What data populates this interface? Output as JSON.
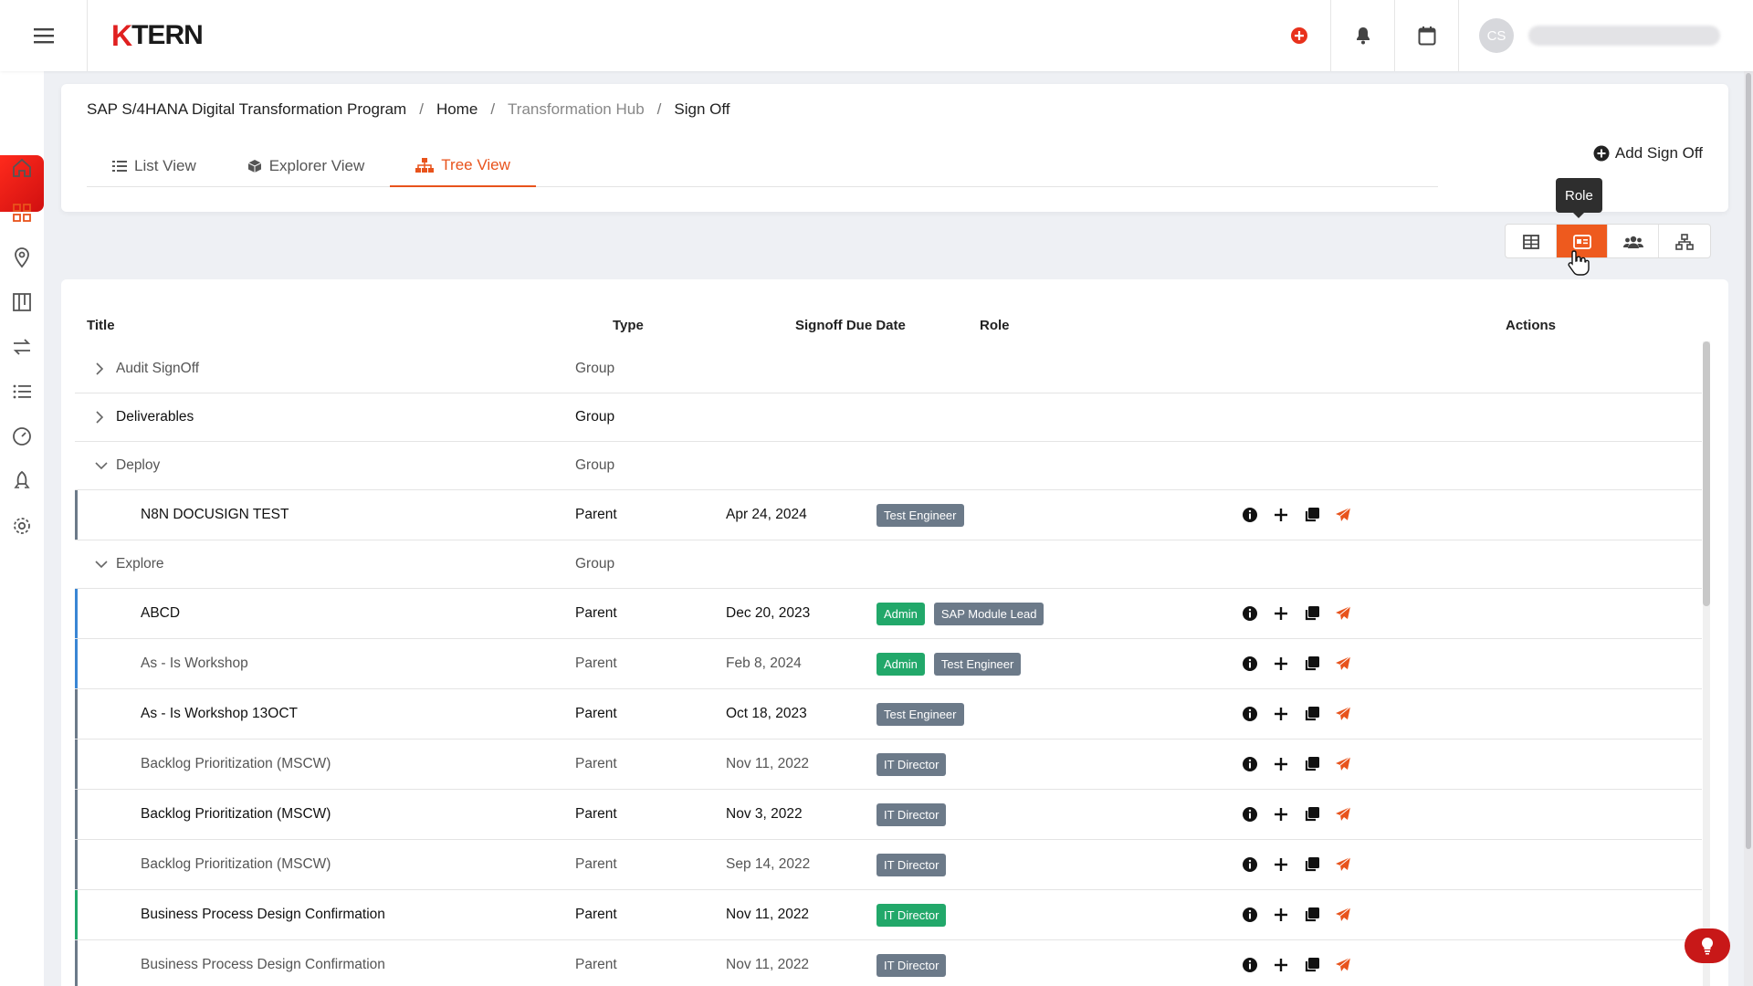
{
  "app": {
    "logo_k": "K",
    "logo_rest": "TERN",
    "avatar_initials": "CS"
  },
  "breadcrumb": {
    "program": "SAP S/4HANA Digital Transformation Program",
    "home": "Home",
    "hub": "Transformation Hub",
    "current": "Sign Off",
    "separator": "/"
  },
  "tabs": [
    {
      "label": "List View",
      "icon": "list-icon"
    },
    {
      "label": "Explorer View",
      "icon": "cube-icon"
    },
    {
      "label": "Tree View",
      "icon": "sitemap-icon",
      "active": true
    }
  ],
  "add_button": "Add Sign Off",
  "view_toggle": {
    "tooltip": "Role",
    "buttons": [
      "table-icon",
      "id-card-icon",
      "users-icon",
      "hierarchy-icon"
    ],
    "active_index": 1
  },
  "table": {
    "columns": {
      "title": "Title",
      "type": "Type",
      "due": "Signoff Due Date",
      "role": "Role",
      "actions": "Actions"
    },
    "rows": [
      {
        "kind": "group",
        "title": "Audit SignOff",
        "type": "Group",
        "expanded": false,
        "bold": false
      },
      {
        "kind": "group",
        "title": "Deliverables",
        "type": "Group",
        "expanded": false,
        "bold": true
      },
      {
        "kind": "group",
        "title": "Deploy",
        "type": "Group",
        "expanded": true,
        "bold": false
      },
      {
        "kind": "child",
        "title": "N8N DOCUSIGN TEST",
        "type": "Parent",
        "due": "Apr 24, 2024",
        "roles": [
          {
            "name": "Test Engineer",
            "color": "#6c7a89"
          }
        ],
        "bar": "#6c7a89",
        "bold": true
      },
      {
        "kind": "group",
        "title": "Explore",
        "type": "Group",
        "expanded": true,
        "bold": false
      },
      {
        "kind": "child",
        "title": "ABCD",
        "type": "Parent",
        "due": "Dec 20, 2023",
        "roles": [
          {
            "name": "Admin",
            "color": "#22a86a"
          },
          {
            "name": "SAP Module Lead",
            "color": "#6c7a89"
          }
        ],
        "bar": "#3a86d4",
        "bold": true
      },
      {
        "kind": "child",
        "title": "As - Is Workshop",
        "type": "Parent",
        "due": "Feb 8, 2024",
        "roles": [
          {
            "name": "Admin",
            "color": "#22a86a"
          },
          {
            "name": "Test Engineer",
            "color": "#6c7a89"
          }
        ],
        "bar": "#3a86d4",
        "bold": false
      },
      {
        "kind": "child",
        "title": "As - Is Workshop 13OCT",
        "type": "Parent",
        "due": "Oct 18, 2023",
        "roles": [
          {
            "name": "Test Engineer",
            "color": "#6c7a89"
          }
        ],
        "bar": "#6c7a89",
        "bold": true
      },
      {
        "kind": "child",
        "title": "Backlog Prioritization (MSCW)",
        "type": "Parent",
        "due": "Nov 11, 2022",
        "roles": [
          {
            "name": "IT Director",
            "color": "#6c7a89"
          }
        ],
        "bar": "#6c7a89",
        "bold": false
      },
      {
        "kind": "child",
        "title": "Backlog Prioritization (MSCW)",
        "type": "Parent",
        "due": "Nov 3, 2022",
        "roles": [
          {
            "name": "IT Director",
            "color": "#6c7a89"
          }
        ],
        "bar": "#6c7a89",
        "bold": true
      },
      {
        "kind": "child",
        "title": "Backlog Prioritization (MSCW)",
        "type": "Parent",
        "due": "Sep 14, 2022",
        "roles": [
          {
            "name": "IT Director",
            "color": "#6c7a89"
          }
        ],
        "bar": "#6c7a89",
        "bold": false
      },
      {
        "kind": "child",
        "title": "Business Process Design Confirmation",
        "type": "Parent",
        "due": "Nov 11, 2022",
        "roles": [
          {
            "name": "IT Director",
            "color": "#22a86a"
          }
        ],
        "bar": "#22a86a",
        "bold": true
      },
      {
        "kind": "child",
        "title": "Business Process Design Confirmation",
        "type": "Parent",
        "due": "Nov 11, 2022",
        "roles": [
          {
            "name": "IT Director",
            "color": "#6c7a89"
          }
        ],
        "bar": "#6c7a89",
        "bold": false
      }
    ]
  },
  "colors": {
    "accent": "#e8531c",
    "brand_red": "#e02020"
  }
}
